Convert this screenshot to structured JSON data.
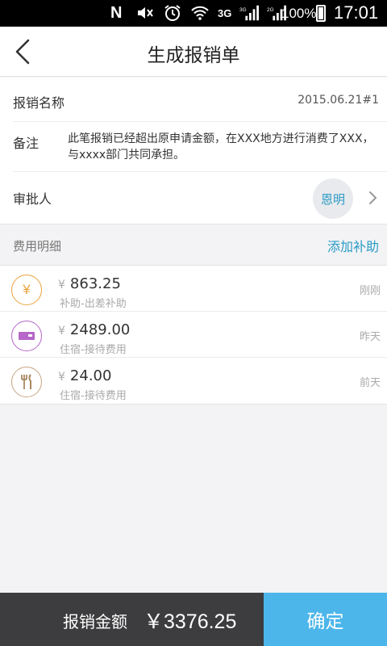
{
  "status_bar": {
    "carrier_glyph": "N",
    "network_3g": "3G",
    "network_3g_small": "3G",
    "network_2g": "2G",
    "battery": "100%",
    "time": "17:01"
  },
  "header": {
    "title": "生成报销单"
  },
  "form": {
    "name_label": "报销名称",
    "name_value": "2015.06.21#1",
    "note_label": "备注",
    "note_value": "此笔报销已经超出原申请金额，在XXX地方进行消费了XXX，与xxxx部门共同承担。",
    "approver_label": "审批人",
    "approver_value": "恩明"
  },
  "section": {
    "title": "费用明细",
    "add_label": "添加补助"
  },
  "expenses": [
    {
      "currency": "¥",
      "amount": "863.25",
      "category": "补助-出差补助",
      "time": "刚刚",
      "icon": "yen-icon",
      "color": "#e8a33c"
    },
    {
      "currency": "¥",
      "amount": "2489.00",
      "category": "住宿-接待费用",
      "time": "昨天",
      "icon": "bed-icon",
      "color": "#b667c9"
    },
    {
      "currency": "¥",
      "amount": "24.00",
      "category": "住宿-接待费用",
      "time": "前天",
      "icon": "fork-knife-icon",
      "color": "#c9a582"
    }
  ],
  "footer": {
    "total_label": "报销金额",
    "total_value": "￥3376.25",
    "confirm_label": "确定"
  },
  "colors": {
    "accent": "#2a9bc6",
    "confirm_bg": "#4cb6ea",
    "footer_bg": "#3d3d3f"
  }
}
